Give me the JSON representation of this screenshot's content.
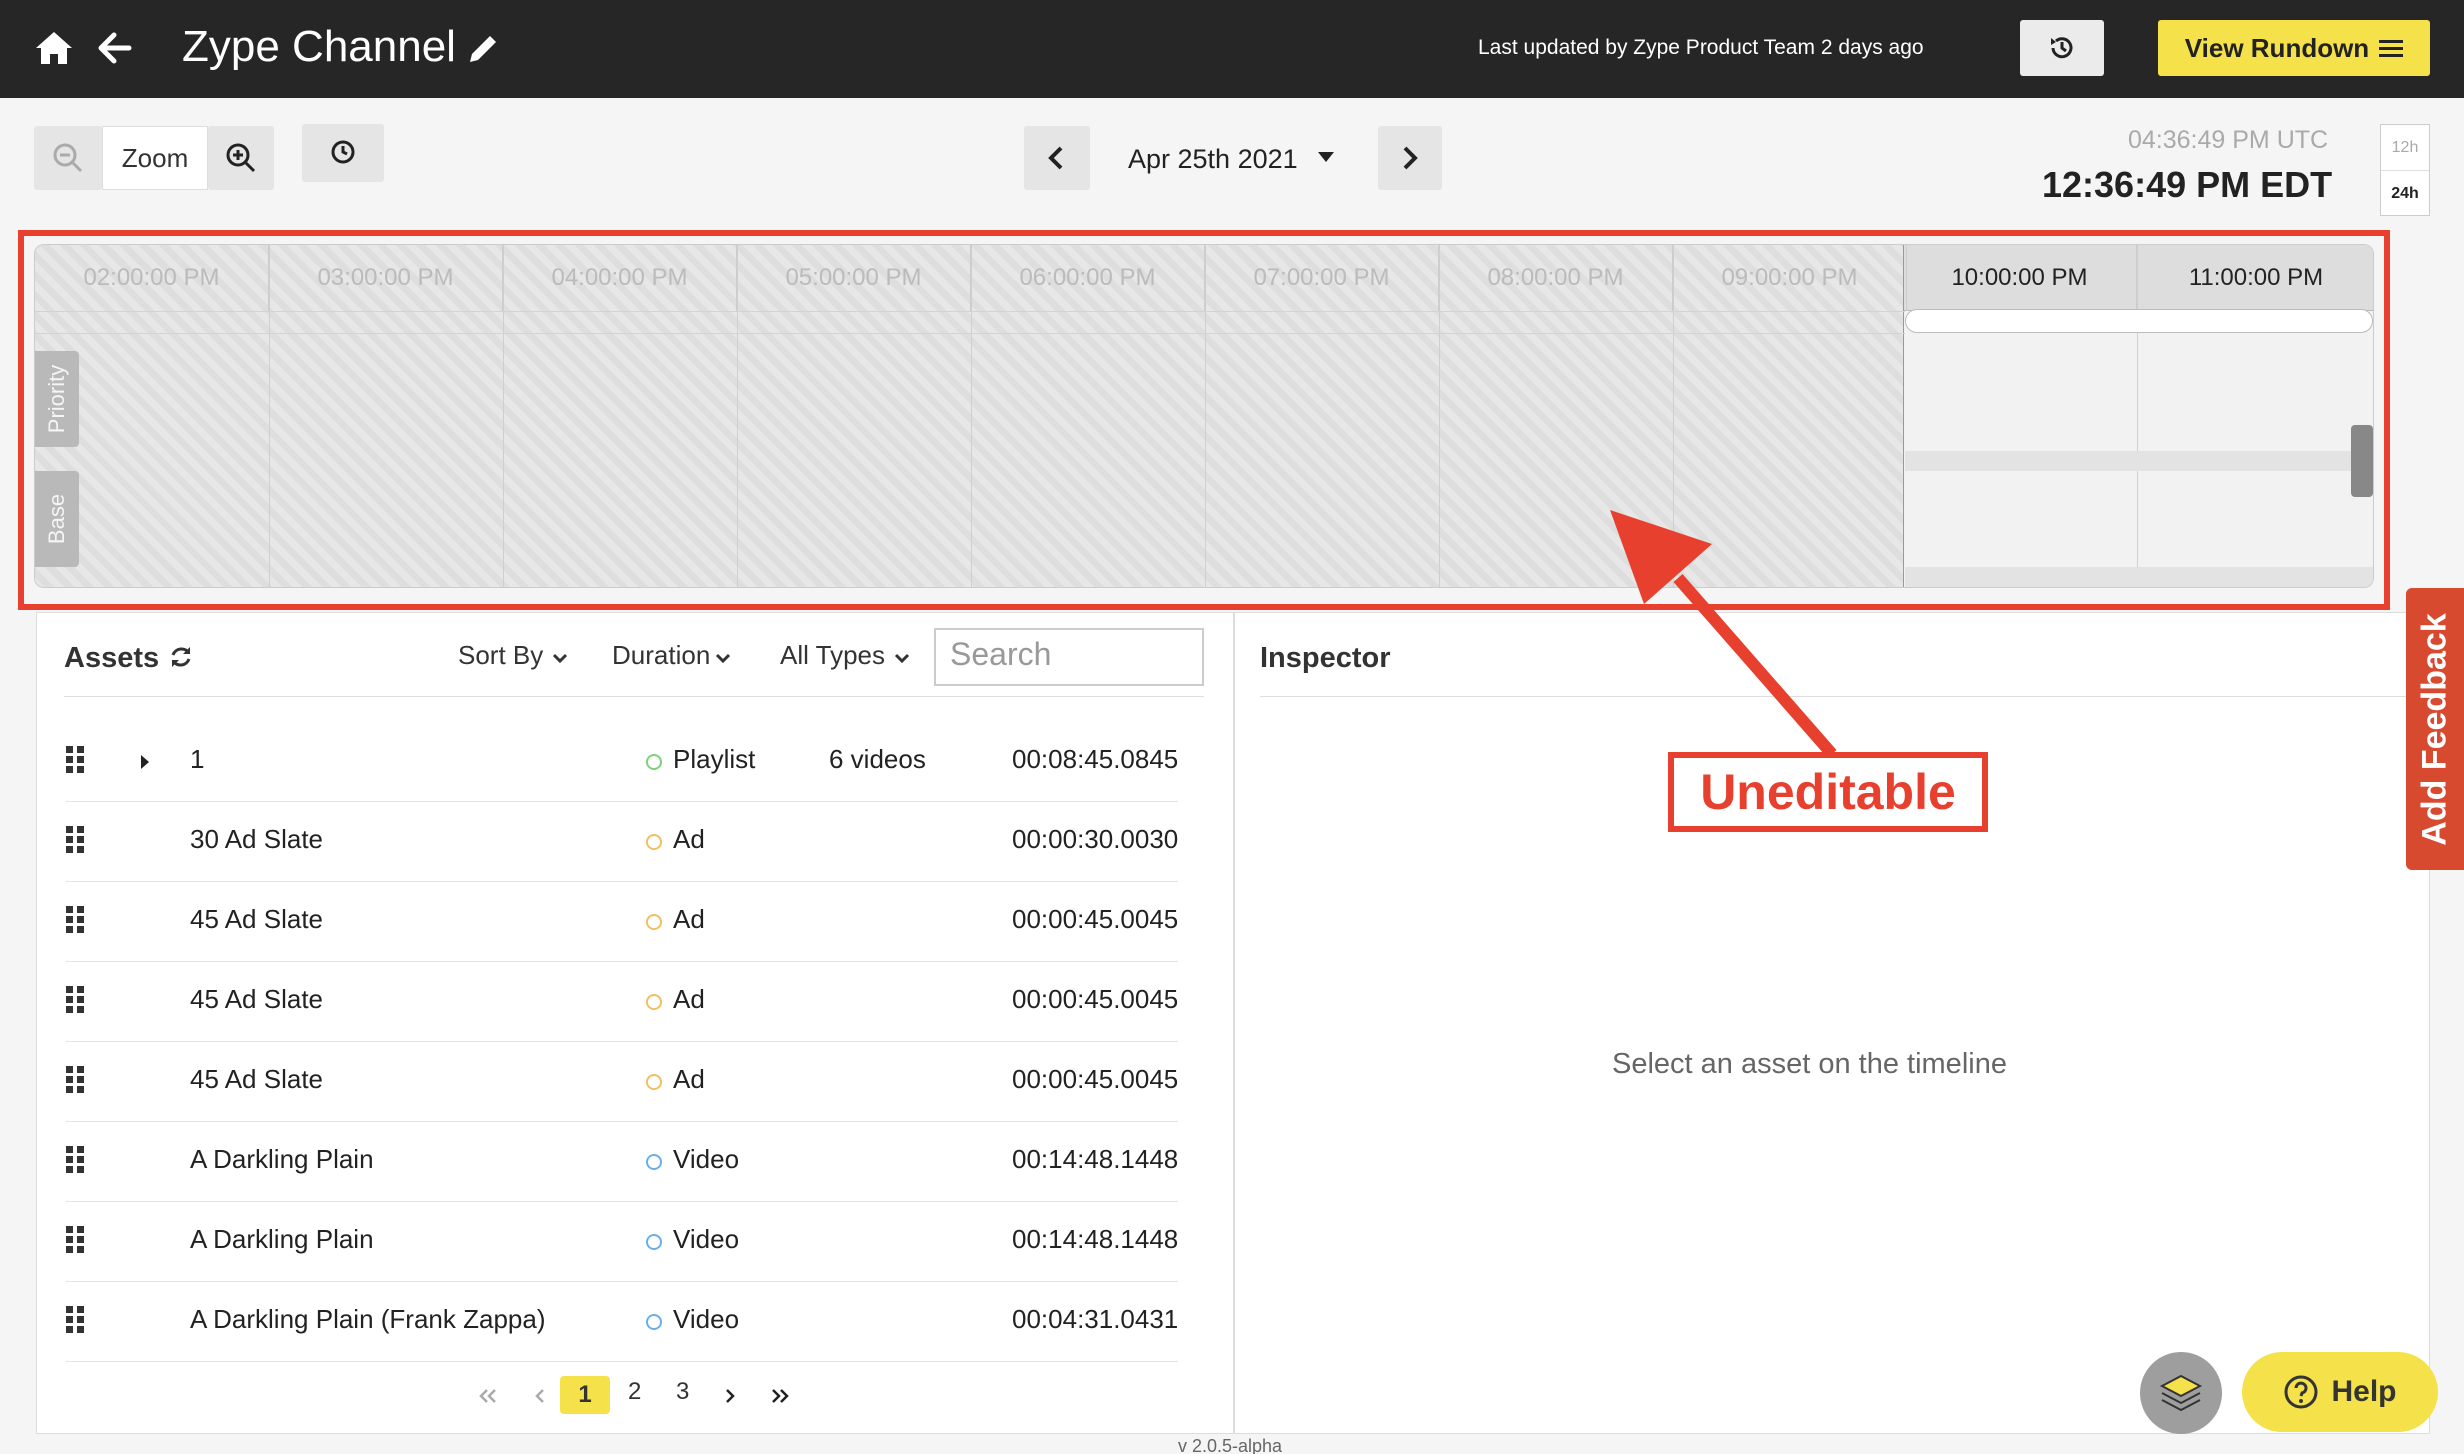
{
  "header": {
    "title": "Zype Channel",
    "last_updated": "Last updated by Zype Product Team 2 days ago",
    "view_rundown": "View Rundown"
  },
  "toolbar": {
    "zoom_label": "Zoom",
    "date": "Apr 25th 2021",
    "time_utc": "04:36:49 PM UTC",
    "time_local": "12:36:49 PM EDT",
    "format_12h": "12h",
    "format_24h": "24h"
  },
  "timeline": {
    "hours": [
      "02:00:00 PM",
      "03:00:00 PM",
      "04:00:00 PM",
      "05:00:00 PM",
      "06:00:00 PM",
      "07:00:00 PM",
      "08:00:00 PM",
      "09:00:00 PM",
      "10:00:00 PM",
      "11:00:00 PM"
    ],
    "lane_priority": "Priority",
    "lane_base": "Base"
  },
  "annotation": {
    "label": "Uneditable"
  },
  "assets": {
    "title": "Assets",
    "sort_by": "Sort By",
    "duration": "Duration",
    "all_types": "All Types",
    "search_placeholder": "Search",
    "rows": [
      {
        "name": "1",
        "type": "Playlist",
        "extra": "6 videos",
        "duration": "00:08:45.0845",
        "color": "#7ed07e"
      },
      {
        "name": "30 Ad Slate",
        "type": "Ad",
        "extra": "",
        "duration": "00:00:30.0030",
        "color": "#f0c060"
      },
      {
        "name": "45 Ad Slate",
        "type": "Ad",
        "extra": "",
        "duration": "00:00:45.0045",
        "color": "#f0c060"
      },
      {
        "name": "45 Ad Slate",
        "type": "Ad",
        "extra": "",
        "duration": "00:00:45.0045",
        "color": "#f0c060"
      },
      {
        "name": "45 Ad Slate",
        "type": "Ad",
        "extra": "",
        "duration": "00:00:45.0045",
        "color": "#f0c060"
      },
      {
        "name": "A Darkling Plain",
        "type": "Video",
        "extra": "",
        "duration": "00:14:48.1448",
        "color": "#6aaee8"
      },
      {
        "name": "A Darkling Plain",
        "type": "Video",
        "extra": "",
        "duration": "00:14:48.1448",
        "color": "#6aaee8"
      },
      {
        "name": "A Darkling Plain (Frank Zappa)",
        "type": "Video",
        "extra": "",
        "duration": "00:04:31.0431",
        "color": "#6aaee8"
      }
    ],
    "pages": [
      "1",
      "2",
      "3"
    ]
  },
  "inspector": {
    "title": "Inspector",
    "empty_message": "Select an asset on the timeline"
  },
  "feedback": "Add Feedback",
  "help": "Help",
  "version": "v 2.0.5-alpha"
}
